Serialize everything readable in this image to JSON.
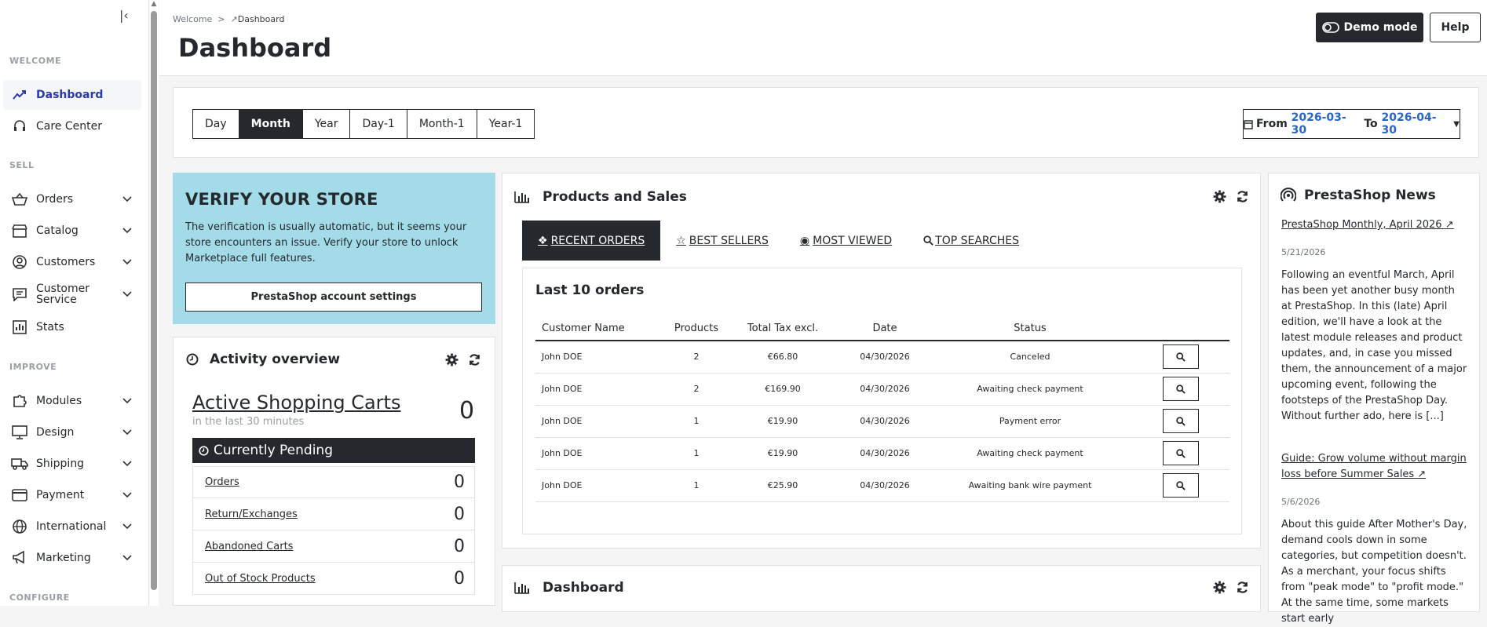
{
  "sidebar": {
    "sections": {
      "welcome": "WELCOME",
      "sell": "SELL",
      "improve": "IMPROVE",
      "configure": "CONFIGURE"
    },
    "items": [
      {
        "label": "Dashboard",
        "icon": "trending-up-icon",
        "active": true
      },
      {
        "label": "Care Center",
        "icon": "headset-icon"
      },
      {
        "label": "Orders",
        "icon": "basket-icon"
      },
      {
        "label": "Catalog",
        "icon": "store-icon"
      },
      {
        "label": "Customers",
        "icon": "user-circle-icon"
      },
      {
        "label": "Customer Service",
        "icon": "chat-icon"
      },
      {
        "label": "Stats",
        "icon": "bar-chart-icon"
      },
      {
        "label": "Modules",
        "icon": "puzzle-icon"
      },
      {
        "label": "Design",
        "icon": "monitor-icon"
      },
      {
        "label": "Shipping",
        "icon": "truck-icon"
      },
      {
        "label": "Payment",
        "icon": "credit-card-icon"
      },
      {
        "label": "International",
        "icon": "globe-icon"
      },
      {
        "label": "Marketing",
        "icon": "megaphone-icon"
      }
    ]
  },
  "header": {
    "breadcrumb": {
      "root": "Welcome",
      "sep": ">",
      "current": "Dashboard"
    },
    "title": "Dashboard",
    "demo_label": "Demo mode",
    "help_label": "Help"
  },
  "filters": {
    "periods": [
      "Day",
      "Month",
      "Year",
      "Day-1",
      "Month-1",
      "Year-1"
    ],
    "active_period": "Month",
    "range": {
      "from_label": "From",
      "from": "2026-03-30",
      "to_label": "To",
      "to": "2026-04-30"
    }
  },
  "verify": {
    "title": "VERIFY YOUR STORE",
    "text": "The verification is usually automatic, but it seems your store encounters an issue. Verify your store to unlock Marketplace full features.",
    "button": "PrestaShop account settings"
  },
  "activity": {
    "title": "Activity overview",
    "carts_label": "Active Shopping Carts",
    "carts_sub": "in the last 30 minutes",
    "carts_value": "0",
    "pending_title": "Currently Pending",
    "pending": [
      {
        "label": "Orders",
        "value": "0"
      },
      {
        "label": "Return/Exchanges",
        "value": "0"
      },
      {
        "label": "Abandoned Carts",
        "value": "0"
      },
      {
        "label": "Out of Stock Products",
        "value": "0"
      }
    ]
  },
  "products": {
    "title": "Products and Sales",
    "tabs": [
      "RECENT ORDERS",
      "BEST SELLERS",
      "MOST VIEWED",
      "TOP SEARCHES"
    ],
    "inner_title": "Last 10 orders",
    "columns": [
      "Customer Name",
      "Products",
      "Total Tax excl.",
      "Date",
      "Status"
    ],
    "rows": [
      [
        "John DOE",
        "2",
        "€66.80",
        "04/30/2026",
        "Canceled"
      ],
      [
        "John DOE",
        "2",
        "€169.90",
        "04/30/2026",
        "Awaiting check payment"
      ],
      [
        "John DOE",
        "1",
        "€19.90",
        "04/30/2026",
        "Payment error"
      ],
      [
        "John DOE",
        "1",
        "€19.90",
        "04/30/2026",
        "Awaiting check payment"
      ],
      [
        "John DOE",
        "1",
        "€25.90",
        "04/30/2026",
        "Awaiting bank wire payment"
      ]
    ]
  },
  "dashboard_card": {
    "title": "Dashboard"
  },
  "news": {
    "title": "PrestaShop News",
    "items": [
      {
        "link": "PrestaShop Monthly, April 2026",
        "date": "5/21/2026",
        "body": "Following an eventful March, April has been yet another busy month at PrestaShop. In this (late) April edition, we'll have a look at the latest module releases and product updates, and, in case you missed them, the announcement of a major upcoming event, following the footsteps of the PrestaShop Day. Without further ado, here is [...]"
      },
      {
        "link": "Guide: Grow volume without margin loss before Summer Sales",
        "date": "5/6/2026",
        "body": "About this guide After Mother's Day, demand cools down in some categories, but competition doesn't. As a merchant, your focus shifts from \"peak mode\" to \"profit mode.\" At the same time, some markets start early"
      }
    ]
  },
  "colors": {
    "dark": "#25292d",
    "accent": "#2b3ba8",
    "verify_bg": "#a4dbe8",
    "date": "#2b66c4"
  }
}
